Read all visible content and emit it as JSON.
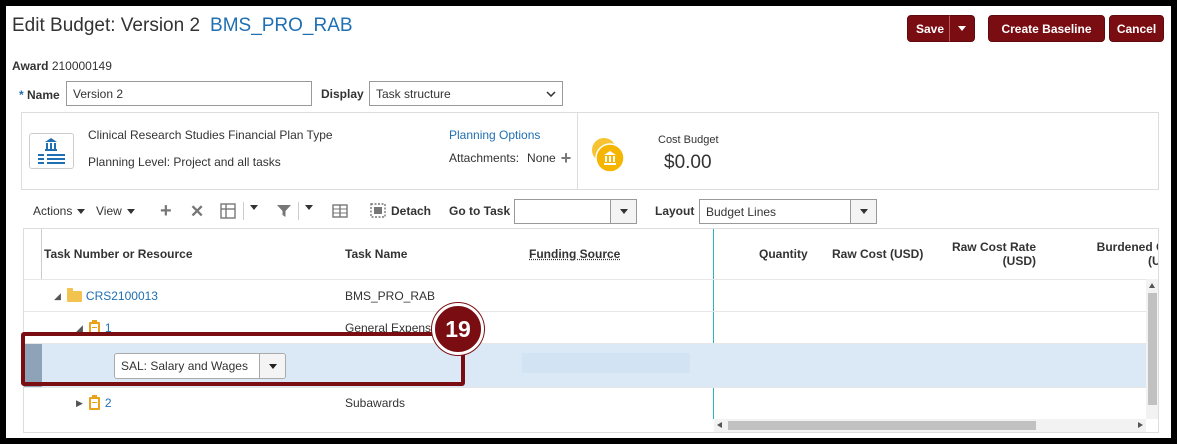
{
  "header": {
    "title": "Edit Budget: Version 2",
    "subtitle": "BMS_PRO_RAB",
    "save_label": "Save",
    "create_baseline_label": "Create Baseline",
    "cancel_label": "Cancel"
  },
  "award": {
    "label": "Award",
    "value": "210000149"
  },
  "form": {
    "name_required_mark": "*",
    "name_label": "Name",
    "name_value": "Version 2",
    "display_label": "Display",
    "display_value": "Task structure"
  },
  "info": {
    "plan_type": "Clinical Research Studies Financial Plan Type",
    "planning_level": "Planning Level: Project and all tasks",
    "planning_options_link": "Planning Options",
    "attachments_label": "Attachments:",
    "attachments_value": "None",
    "cost_budget_label": "Cost Budget",
    "cost_budget_value": "$0.00"
  },
  "toolbar": {
    "actions_label": "Actions",
    "view_label": "View",
    "detach_label": "Detach",
    "go_to_task_label": "Go to Task",
    "go_to_task_value": "",
    "layout_label": "Layout",
    "layout_value": "Budget Lines"
  },
  "table": {
    "columns": {
      "task_number": "Task Number or Resource",
      "task_name": "Task Name",
      "funding_source": "Funding Source",
      "quantity": "Quantity",
      "raw_cost": "Raw Cost (USD)",
      "raw_cost_rate_1": "Raw Cost Rate",
      "raw_cost_rate_2": "(USD)",
      "burdened_1": "Burdened Co",
      "burdened_2": "(USI"
    },
    "rows": [
      {
        "task_number": "CRS2100013",
        "task_name": "BMS_PRO_RAB"
      },
      {
        "task_number": "1",
        "task_name": "General Expense"
      },
      {
        "resource_value": "SAL: Salary and Wages"
      },
      {
        "task_number": "2",
        "task_name": "Subawards"
      }
    ]
  },
  "callout": {
    "step_number": "19"
  },
  "colors": {
    "brand_button": "#7a0d12",
    "link": "#1f6fb3",
    "selected_row": "#dbe9f7",
    "callout": "#7a0d12"
  }
}
